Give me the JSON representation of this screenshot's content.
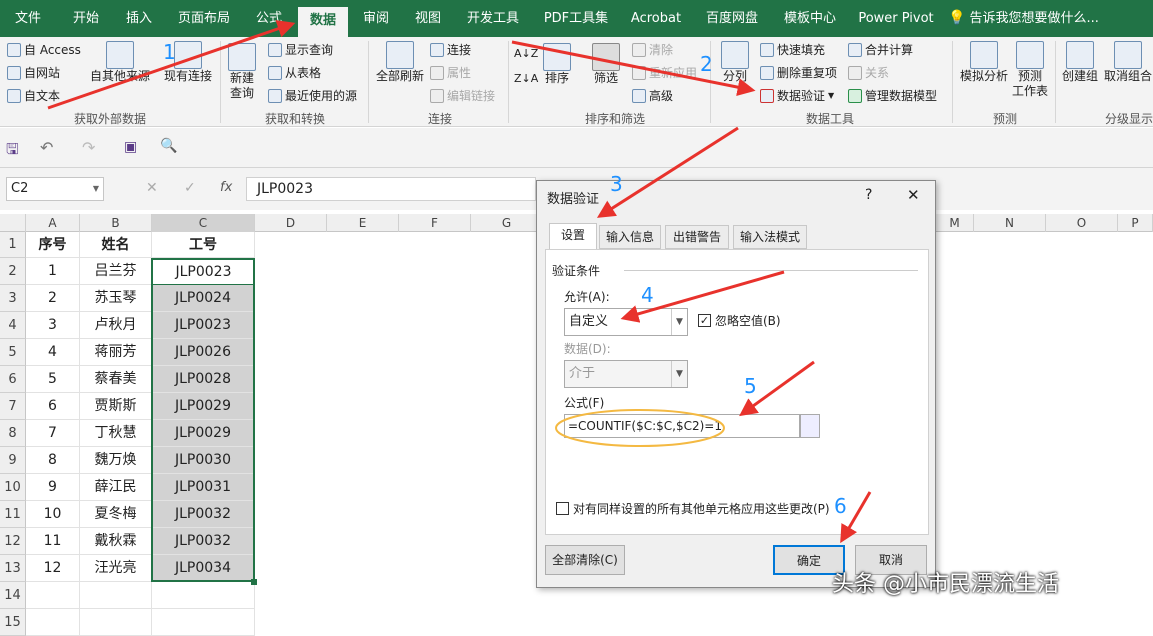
{
  "ribbon_tabs": [
    "文件",
    "开始",
    "插入",
    "页面布局",
    "公式",
    "数据",
    "审阅",
    "视图",
    "开发工具",
    "PDF工具集",
    "Acrobat",
    "百度网盘",
    "模板中心",
    "Power Pivot",
    "告诉我您想要做什么..."
  ],
  "ribbon": {
    "get_external": {
      "access": "自 Access",
      "web": "自网站",
      "text": "自文本",
      "other": "自其他来源",
      "existing": "现有连接",
      "group": "获取外部数据"
    },
    "transform": {
      "new_query": "新建\n查询",
      "show_query": "显示查询",
      "from_table": "从表格",
      "recent": "最近使用的源",
      "group": "获取和转换"
    },
    "connections": {
      "refresh_all": "全部刷新",
      "connections": "连接",
      "properties": "属性",
      "edit_links": "编辑链接",
      "group": "连接"
    },
    "sort_filter": {
      "sort": "排序",
      "filter": "筛选",
      "clear": "清除",
      "reapply": "重新应用",
      "advanced": "高级",
      "group": "排序和筛选"
    },
    "data_tools": {
      "split": "分列",
      "flash_fill": "快速填充",
      "remove_dup": "删除重复项",
      "validation": "数据验证",
      "consolidate": "合并计算",
      "relations": "关系",
      "manage_model": "管理数据模型",
      "group": "数据工具"
    },
    "forecast": {
      "whatif": "模拟分析",
      "sheet": "预测\n工作表",
      "group": "预测"
    },
    "outline": {
      "group_btn": "创建组",
      "ungroup": "取消组合",
      "group": "分级显示"
    }
  },
  "formula_bar": {
    "cell_ref": "C2",
    "fx": "fx",
    "value": "JLP0023"
  },
  "columns": [
    "A",
    "B",
    "C",
    "D",
    "E",
    "F",
    "G",
    "M",
    "N",
    "O",
    "P"
  ],
  "rows": [
    "1",
    "2",
    "3",
    "4",
    "5",
    "6",
    "7",
    "8",
    "9",
    "10",
    "11",
    "12",
    "13",
    "14",
    "15"
  ],
  "table": {
    "headers": [
      "序号",
      "姓名",
      "工号"
    ],
    "data": [
      [
        "1",
        "吕兰芬",
        "JLP0023"
      ],
      [
        "2",
        "苏玉琴",
        "JLP0024"
      ],
      [
        "3",
        "卢秋月",
        "JLP0023"
      ],
      [
        "4",
        "蒋丽芳",
        "JLP0026"
      ],
      [
        "5",
        "蔡春美",
        "JLP0028"
      ],
      [
        "6",
        "贾斯斯",
        "JLP0029"
      ],
      [
        "7",
        "丁秋慧",
        "JLP0029"
      ],
      [
        "8",
        "魏万焕",
        "JLP0030"
      ],
      [
        "9",
        "薛江民",
        "JLP0031"
      ],
      [
        "10",
        "夏冬梅",
        "JLP0032"
      ],
      [
        "11",
        "戴秋霖",
        "JLP0032"
      ],
      [
        "12",
        "汪光亮",
        "JLP0034"
      ]
    ]
  },
  "dialog": {
    "title": "数据验证",
    "help": "?",
    "close": "✕",
    "tabs": [
      "设置",
      "输入信息",
      "出错警告",
      "输入法模式"
    ],
    "section": "验证条件",
    "allow_label": "允许(A):",
    "allow_value": "自定义",
    "ignore_blank": "忽略空值(B)",
    "data_label": "数据(D):",
    "data_value": "介于",
    "formula_label": "公式(F)",
    "formula_value": "=COUNTIF($C:$C,$C2)=1",
    "apply_all": "对有同样设置的所有其他单元格应用这些更改(P)",
    "clear_all": "全部清除(C)",
    "ok": "确定",
    "cancel": "取消"
  },
  "step_numbers": [
    "1",
    "2",
    "3",
    "4",
    "5",
    "6"
  ],
  "watermark": "头条 @小市民漂流生活",
  "colors": {
    "accent": "#217346",
    "arrow": "#e8322c",
    "highlight": "#f4b942",
    "step": "#1e90ff"
  }
}
